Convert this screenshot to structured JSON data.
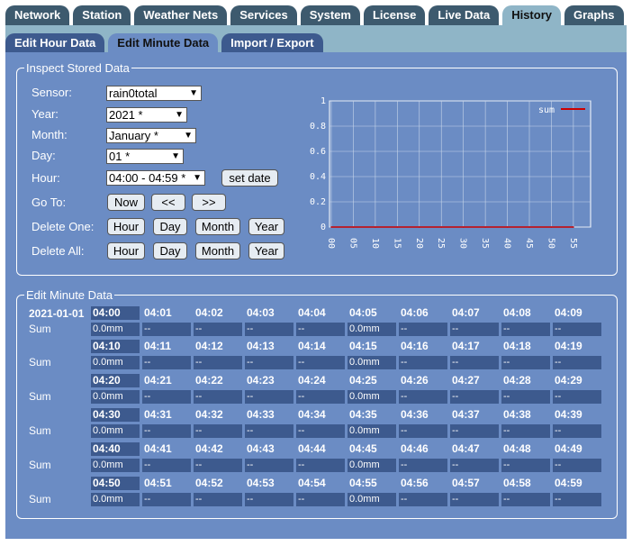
{
  "top_tabs": [
    "Network",
    "Station",
    "Weather Nets",
    "Services",
    "System",
    "License",
    "Live Data",
    "History",
    "Graphs"
  ],
  "active_top_tab": "History",
  "sub_tabs": [
    "Edit Hour Data",
    "Edit Minute Data",
    "Import / Export"
  ],
  "active_sub_tab": "Edit Minute Data",
  "inspect": {
    "legend": "Inspect Stored Data",
    "sensor_label": "Sensor:",
    "sensor_value": "rain0total",
    "year_label": "Year:",
    "year_value": "2021 *",
    "month_label": "Month:",
    "month_value": "January *",
    "day_label": "Day:",
    "day_value": "01 *",
    "hour_label": "Hour:",
    "hour_value": "04:00 - 04:59 *",
    "set_date": "set date",
    "goto_label": "Go To:",
    "now": "Now",
    "prev": "<<",
    "next": ">>",
    "delete_one_label": "Delete One:",
    "delete_all_label": "Delete All:",
    "hour_btn": "Hour",
    "day_btn": "Day",
    "month_btn": "Month",
    "year_btn": "Year"
  },
  "chart_data": {
    "type": "line",
    "series": [
      {
        "name": "sum",
        "values": [
          0,
          0,
          0,
          0,
          0,
          0,
          0,
          0,
          0,
          0,
          0,
          0
        ],
        "color": "#cc0000"
      }
    ],
    "x_ticks": [
      "00",
      "05",
      "10",
      "15",
      "20",
      "25",
      "30",
      "35",
      "40",
      "45",
      "50",
      "55"
    ],
    "y_ticks": [
      "0",
      "0.2",
      "0.4",
      "0.6",
      "0.8",
      "1"
    ],
    "ylim": [
      0,
      1
    ],
    "grid": true,
    "legend_position": "top-right"
  },
  "edit": {
    "legend": "Edit Minute Data",
    "date": "2021-01-01",
    "sum_label": "Sum",
    "rows": [
      {
        "times": [
          "04:00",
          "04:01",
          "04:02",
          "04:03",
          "04:04",
          "04:05",
          "04:06",
          "04:07",
          "04:08",
          "04:09"
        ],
        "values": [
          "0.0mm",
          "--",
          "--",
          "--",
          "--",
          "0.0mm",
          "--",
          "--",
          "--",
          "--"
        ]
      },
      {
        "times": [
          "04:10",
          "04:11",
          "04:12",
          "04:13",
          "04:14",
          "04:15",
          "04:16",
          "04:17",
          "04:18",
          "04:19"
        ],
        "values": [
          "0.0mm",
          "--",
          "--",
          "--",
          "--",
          "0.0mm",
          "--",
          "--",
          "--",
          "--"
        ]
      },
      {
        "times": [
          "04:20",
          "04:21",
          "04:22",
          "04:23",
          "04:24",
          "04:25",
          "04:26",
          "04:27",
          "04:28",
          "04:29"
        ],
        "values": [
          "0.0mm",
          "--",
          "--",
          "--",
          "--",
          "0.0mm",
          "--",
          "--",
          "--",
          "--"
        ]
      },
      {
        "times": [
          "04:30",
          "04:31",
          "04:32",
          "04:33",
          "04:34",
          "04:35",
          "04:36",
          "04:37",
          "04:38",
          "04:39"
        ],
        "values": [
          "0.0mm",
          "--",
          "--",
          "--",
          "--",
          "0.0mm",
          "--",
          "--",
          "--",
          "--"
        ]
      },
      {
        "times": [
          "04:40",
          "04:41",
          "04:42",
          "04:43",
          "04:44",
          "04:45",
          "04:46",
          "04:47",
          "04:48",
          "04:49"
        ],
        "values": [
          "0.0mm",
          "--",
          "--",
          "--",
          "--",
          "0.0mm",
          "--",
          "--",
          "--",
          "--"
        ]
      },
      {
        "times": [
          "04:50",
          "04:51",
          "04:52",
          "04:53",
          "04:54",
          "04:55",
          "04:56",
          "04:57",
          "04:58",
          "04:59"
        ],
        "values": [
          "0.0mm",
          "--",
          "--",
          "--",
          "--",
          "0.0mm",
          "--",
          "--",
          "--",
          "--"
        ]
      }
    ]
  }
}
